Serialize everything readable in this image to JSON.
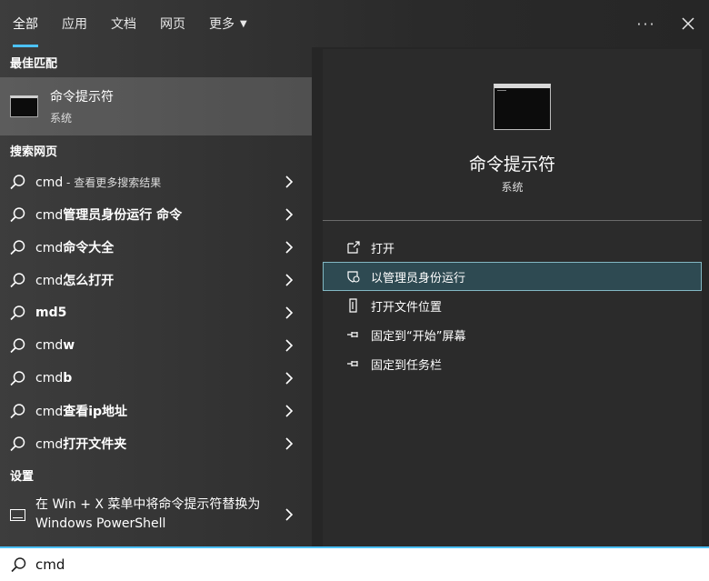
{
  "tabs": [
    {
      "label": "全部",
      "active": true
    },
    {
      "label": "应用"
    },
    {
      "label": "文档"
    },
    {
      "label": "网页"
    },
    {
      "label": "更多"
    }
  ],
  "top_actions": {
    "more": "···"
  },
  "best_match": {
    "title": "最佳匹配",
    "app_name": "命令提示符",
    "app_type": "系统"
  },
  "web": {
    "title": "搜索网页",
    "items": [
      {
        "prefix": "cmd",
        "bold": "",
        "note": " - 查看更多搜索结果"
      },
      {
        "prefix": "cmd",
        "bold": "管理员身份运行 命令",
        "note": ""
      },
      {
        "prefix": "cmd",
        "bold": "命令大全",
        "note": ""
      },
      {
        "prefix": "cmd",
        "bold": "怎么打开",
        "note": ""
      },
      {
        "prefix": "",
        "bold": "md5",
        "note": ""
      },
      {
        "prefix": "cmd",
        "bold": "w",
        "note": ""
      },
      {
        "prefix": "cmd",
        "bold": "b",
        "note": ""
      },
      {
        "prefix": "cmd",
        "bold": "查看ip地址",
        "note": ""
      },
      {
        "prefix": "cmd",
        "bold": "打开文件夹",
        "note": ""
      }
    ]
  },
  "settings": {
    "title": "设置",
    "item": "在 Win + X 菜单中将命令提示符替换为 Windows PowerShell"
  },
  "detail": {
    "app_name": "命令提示符",
    "app_type": "系统",
    "actions": [
      {
        "label": "打开",
        "icon": "open-icon"
      },
      {
        "label": "以管理员身份运行",
        "icon": "shield-icon",
        "selected": true
      },
      {
        "label": "打开文件位置",
        "icon": "file-location-icon"
      },
      {
        "label": "固定到“开始”屏幕",
        "icon": "pin-icon"
      },
      {
        "label": "固定到任务栏",
        "icon": "pin-icon"
      }
    ]
  },
  "search": {
    "value": "cmd"
  },
  "colors": {
    "accent": "#4cc2ff",
    "selected_action_bg": "#2e4a52"
  }
}
